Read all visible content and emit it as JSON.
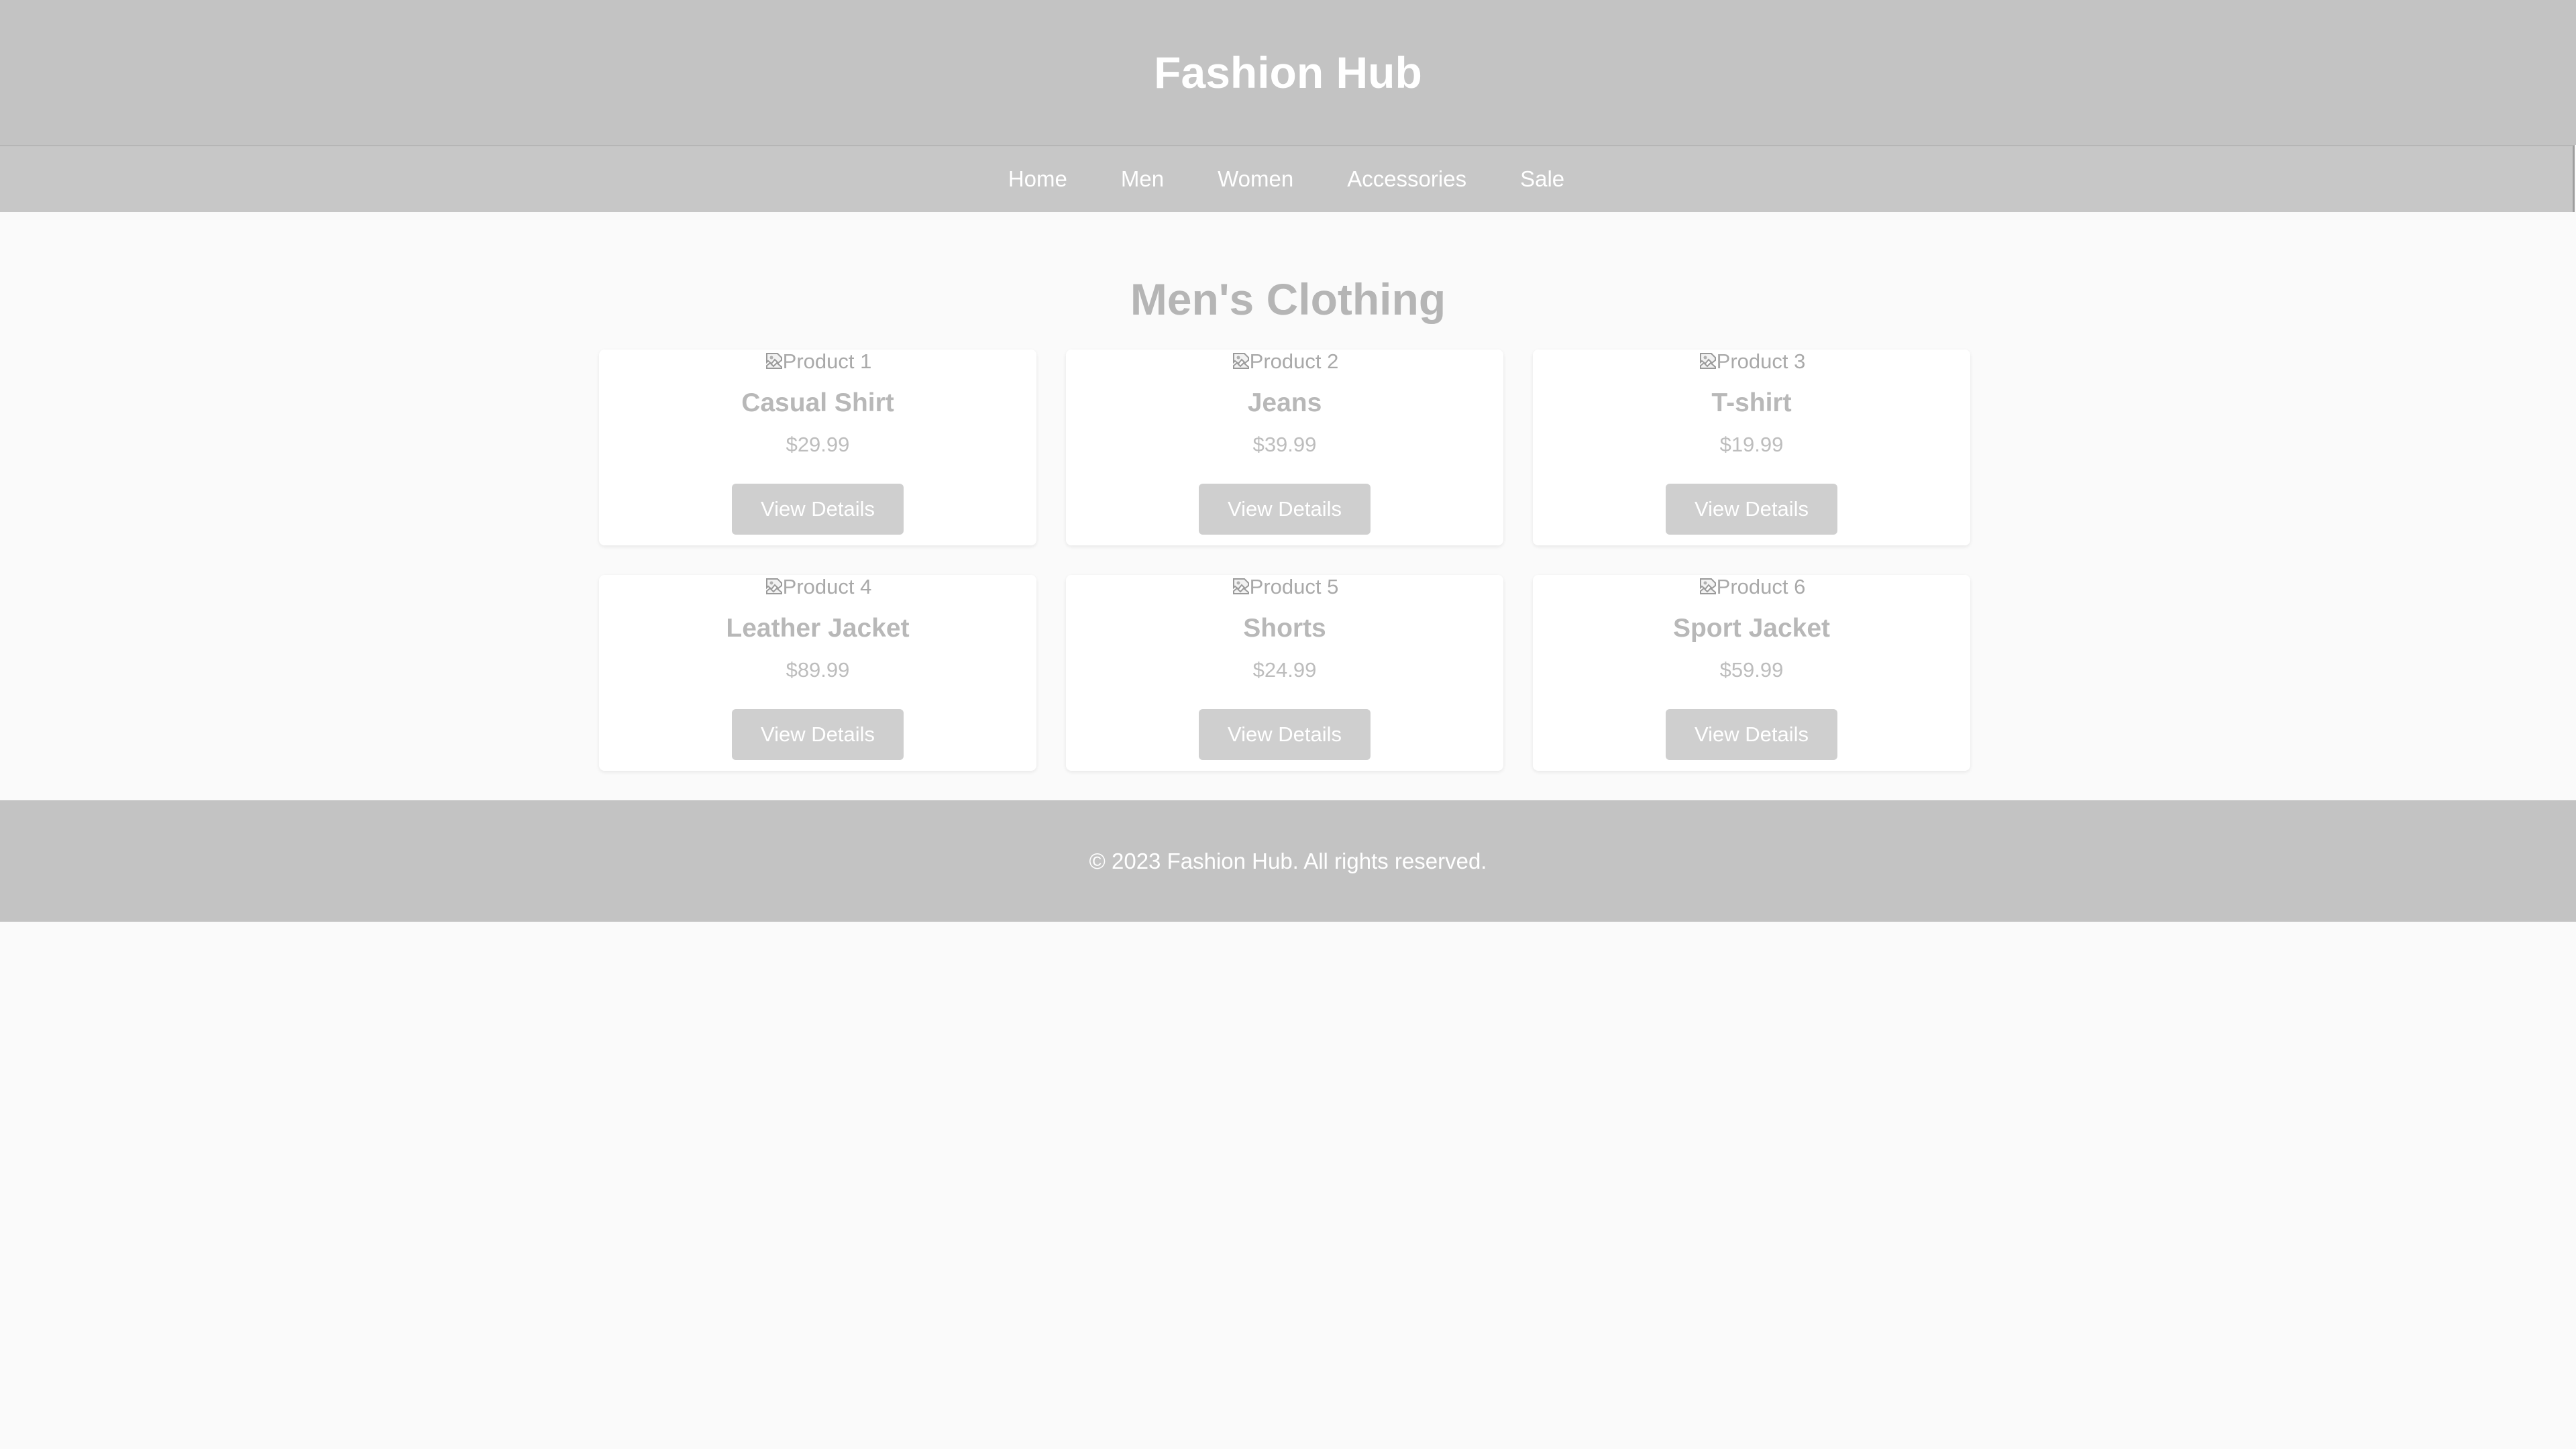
{
  "header": {
    "title": "Fashion Hub"
  },
  "nav": {
    "items": [
      {
        "label": "Home"
      },
      {
        "label": "Men"
      },
      {
        "label": "Women"
      },
      {
        "label": "Accessories"
      },
      {
        "label": "Sale"
      }
    ]
  },
  "main": {
    "section_title": "Men's Clothing",
    "products": [
      {
        "image_alt": "Product 1",
        "name": "Casual Shirt",
        "price": "$29.99",
        "button_label": "View Details"
      },
      {
        "image_alt": "Product 2",
        "name": "Jeans",
        "price": "$39.99",
        "button_label": "View Details"
      },
      {
        "image_alt": "Product 3",
        "name": "T-shirt",
        "price": "$19.99",
        "button_label": "View Details"
      },
      {
        "image_alt": "Product 4",
        "name": "Leather Jacket",
        "price": "$89.99",
        "button_label": "View Details"
      },
      {
        "image_alt": "Product 5",
        "name": "Shorts",
        "price": "$24.99",
        "button_label": "View Details"
      },
      {
        "image_alt": "Product 6",
        "name": "Sport Jacket",
        "price": "$59.99",
        "button_label": "View Details"
      }
    ]
  },
  "footer": {
    "text": "© 2023 Fashion Hub. All rights reserved."
  },
  "icons": {
    "product_image": "broken-image-icon"
  },
  "colors": {
    "header_bg": "#c3c3c3",
    "nav_bg": "#c7c7c7",
    "page_bg": "#fafafa",
    "button_bg": "#cfcfcf",
    "heading_text": "#b5b5b5"
  }
}
